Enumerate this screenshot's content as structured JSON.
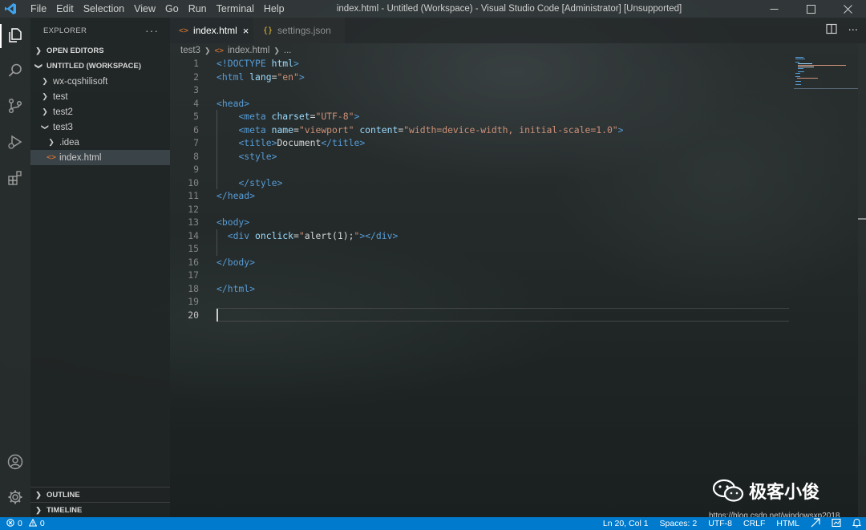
{
  "titlebar": {
    "menu": [
      "File",
      "Edit",
      "Selection",
      "View",
      "Go",
      "Run",
      "Terminal",
      "Help"
    ],
    "title": "index.html - Untitled (Workspace) - Visual Studio Code [Administrator] [Unsupported]"
  },
  "sidebar": {
    "header": "EXPLORER",
    "more": "···",
    "open_editors": "OPEN EDITORS",
    "workspace": "UNTITLED (WORKSPACE)",
    "tree": [
      "wx-cqshilisoft",
      "test",
      "test2",
      "test3",
      ".idea",
      "index.html"
    ],
    "outline": "OUTLINE",
    "timeline": "TIMELINE"
  },
  "tabs": [
    {
      "label": "index.html",
      "icon": "<>",
      "close": "×"
    },
    {
      "label": "settings.json",
      "icon": "{}"
    }
  ],
  "breadcrumb": {
    "folder": "test3",
    "file": "index.html",
    "rest": "..."
  },
  "editor": {
    "line_numbers": [
      "1",
      "2",
      "3",
      "4",
      "5",
      "6",
      "7",
      "8",
      "9",
      "10",
      "11",
      "12",
      "13",
      "14",
      "15",
      "16",
      "17",
      "18",
      "19",
      "20"
    ],
    "current_line": 20
  },
  "statusbar": {
    "errors": "0",
    "warnings": "0",
    "position": "Ln 20, Col 1",
    "spaces": "Spaces: 2",
    "encoding": "UTF-8",
    "eol": "CRLF",
    "language": "HTML"
  },
  "watermark": {
    "brand": "极客小俊",
    "url": "https://blog.csdn.net/windowsxp2018"
  },
  "colors": {
    "statusbar": "#007acc",
    "tag": "#569cd6",
    "attribute": "#9cdcfe",
    "string": "#ce9178",
    "text": "#d4d4d4"
  }
}
